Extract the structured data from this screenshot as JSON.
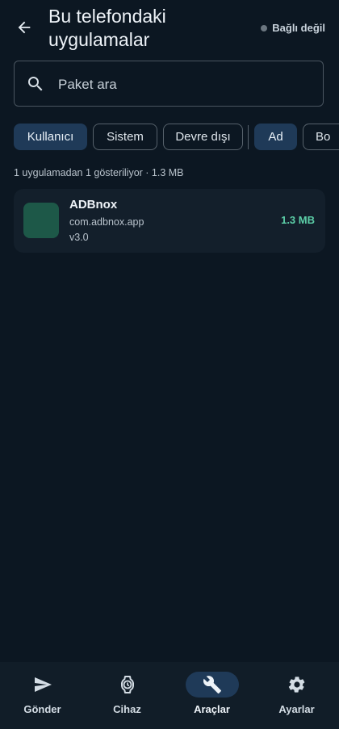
{
  "header": {
    "title": "Bu telefondaki uygulamalar",
    "status": "Bağlı değil"
  },
  "search": {
    "placeholder": "Paket ara",
    "value": ""
  },
  "filters": {
    "chips": [
      {
        "label": "Kullanıcı",
        "selected": true
      },
      {
        "label": "Sistem",
        "selected": false
      },
      {
        "label": "Devre dışı",
        "selected": false
      },
      {
        "label": "Ad",
        "selected": true
      },
      {
        "label": "Bo",
        "selected": false
      }
    ]
  },
  "summary": "1 uygulamadan 1 gösteriliyor · 1.3 MB",
  "apps": [
    {
      "name": "ADBnox",
      "package": "com.adbnox.app",
      "version": "v3.0",
      "size": "1.3 MB",
      "icon_color": "#1d5848"
    }
  ],
  "bottom_nav": {
    "items": [
      {
        "label": "Gönder",
        "icon": "send-icon",
        "active": false
      },
      {
        "label": "Cihaz",
        "icon": "watch-icon",
        "active": false
      },
      {
        "label": "Araçlar",
        "icon": "wrench-icon",
        "active": true
      },
      {
        "label": "Ayarlar",
        "icon": "gear-icon",
        "active": false
      }
    ]
  },
  "colors": {
    "background": "#0c1722",
    "accent_chip": "#1f3a58",
    "size_text": "#5ccfa8"
  }
}
